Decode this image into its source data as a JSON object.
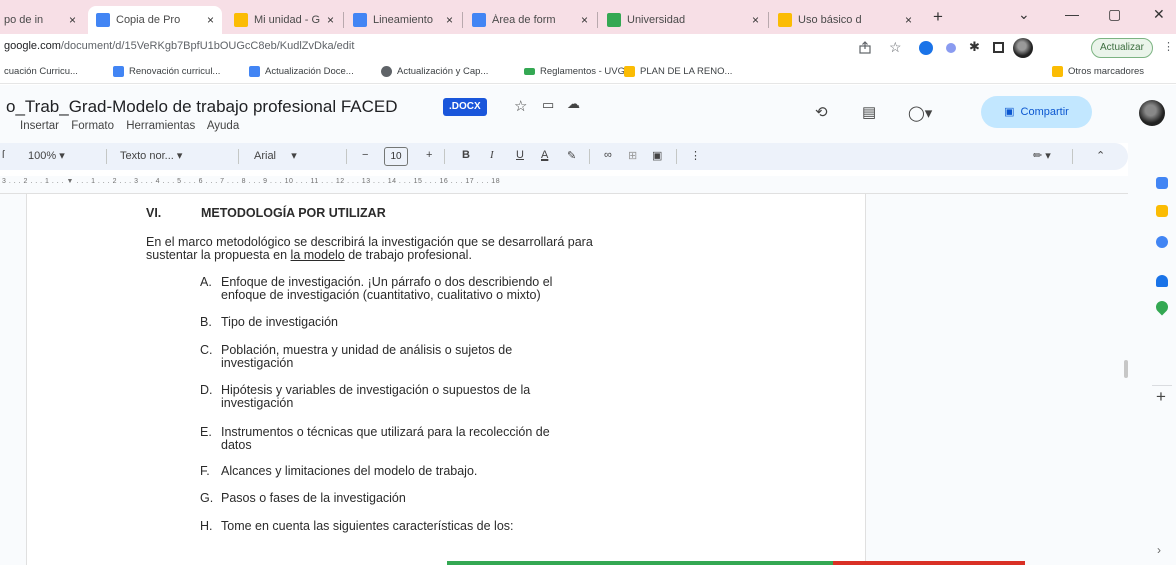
{
  "browser": {
    "tabs": [
      {
        "title": "po de in",
        "favicon_color": "#4285f4",
        "active": false
      },
      {
        "title": "Copia de Pro",
        "favicon_color": "#4285f4",
        "active": true
      },
      {
        "title": "Mi unidad - G",
        "favicon_color": "#fbbc04",
        "active": false
      },
      {
        "title": "Lineamiento",
        "favicon_color": "#4285f4",
        "active": false
      },
      {
        "title": "Área de form",
        "favicon_color": "#4285f4",
        "active": false
      },
      {
        "title": "Universidad",
        "favicon_color": "#34a853",
        "active": false
      },
      {
        "title": "Uso básico d",
        "favicon_color": "#fbbc04",
        "active": false
      }
    ],
    "new_tab": "+",
    "close": "×",
    "window": {
      "collapse": "⌄",
      "minimize": "—",
      "restore": "▢",
      "close": "✕"
    },
    "url_domain": "google.com",
    "url_path": "/document/d/15VeRKgb7BpfU1bOUGcC8eb/KudlZvDka/edit",
    "update_label": "Actualizar",
    "bookmarks": [
      {
        "label": "cuación Curricu...",
        "icon_color": "#ffffff"
      },
      {
        "label": "Renovación curricul...",
        "icon_color": "#4285f4"
      },
      {
        "label": "Actualización Doce...",
        "icon_color": "#4285f4"
      },
      {
        "label": "Actualización y Cap...",
        "icon_color": "#5f6368"
      },
      {
        "label": "Reglamentos - UVG",
        "icon_color": "#34a853"
      },
      {
        "label": "PLAN DE LA RENO...",
        "icon_color": "#fbbc04"
      }
    ],
    "other_bookmarks": "Otros marcadores"
  },
  "doc": {
    "title": "o_Trab_Grad-Modelo de trabajo profesional FACED",
    "badge": ".DOCX",
    "menus": [
      "Insertar",
      "Formato",
      "Herramientas",
      "Ayuda"
    ],
    "share_label": "Compartir",
    "toolbar": {
      "zoom": "100%",
      "style": "Texto nor...",
      "font": "Arial",
      "font_size": "10",
      "minus": "−",
      "plus": "+",
      "bold": "B",
      "italic": "I",
      "underline": "U",
      "text_color": "A"
    },
    "ruler": "3 . . . 2 . . . 1 . . . ▼ . . . 1 . . . 2 . . . 3 . . . 4 . . . 5 . . . 6 . . . 7 . . . 8 . . . 9 . . . 10 . . . 11 . . . 12 . . . 13 . . . 14 . . . 15 . . . 16 . . . 17 . . . 18",
    "section_number": "VI.",
    "section_title": "METODOLOGÍA POR UTILIZAR",
    "intro_line1": "En el marco metodológico se describirá la investigación que se desarrollará para",
    "intro_line2_pre": "sustentar la propuesta en ",
    "intro_line2_link": "la modelo",
    "intro_line2_post": " de trabajo profesional.",
    "items": [
      {
        "letter": "A.",
        "lines": [
          "Enfoque  de  investigación. ¡Un  párrafo  o  dos  describiendo  el",
          "enfoque de investigación (cuantitativo, cualitativo o mixto)"
        ]
      },
      {
        "letter": "B.",
        "lines": [
          "Tipo de investigación"
        ]
      },
      {
        "letter": "C.",
        "lines": [
          "Población,    muestra    y    unidad    de    análisis    o    sujetos    de",
          "investigación"
        ]
      },
      {
        "letter": "D.",
        "lines": [
          "Hipótesis   y   variables   de   investigación   o   supuestos   de   la",
          "investigación"
        ]
      },
      {
        "letter": "E.",
        "lines": [
          "Instrumentos   o   técnicas   que   utilizará   para   la   recolección   de",
          "datos"
        ]
      },
      {
        "letter": "F.",
        "lines": [
          "Alcances y limitaciones del modelo de trabajo."
        ]
      },
      {
        "letter": "G.",
        "lines": [
          "Pasos o fases de la investigación"
        ]
      },
      {
        "letter": "H.",
        "lines": [
          "Tome en cuenta las siguientes características de los:"
        ]
      }
    ]
  },
  "side_panel": {
    "icons": [
      {
        "name": "calendar-icon",
        "color": "#4285f4"
      },
      {
        "name": "keep-icon",
        "color": "#fbbc04"
      },
      {
        "name": "tasks-icon",
        "color": "#4285f4"
      },
      {
        "name": "contacts-icon",
        "color": "#1a73e8"
      },
      {
        "name": "maps-icon",
        "color": "#34a853"
      }
    ],
    "add": "+",
    "expand": "›"
  },
  "progress": {
    "green_fraction": 0.667,
    "color_green": "#34a853",
    "color_red": "#d93025"
  }
}
